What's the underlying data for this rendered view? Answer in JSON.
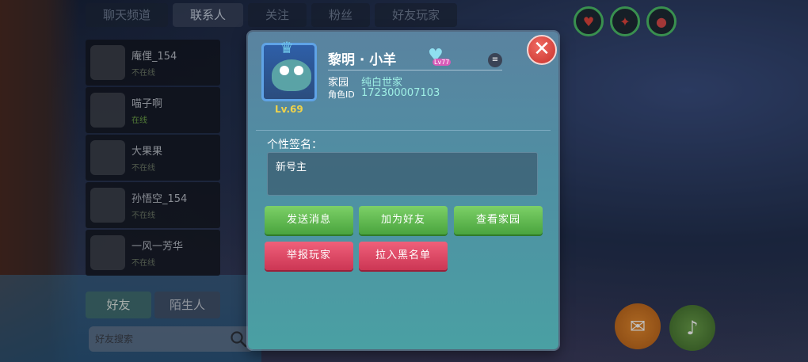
{
  "background_tabs": [
    "聊天频道",
    "联系人",
    "关注",
    "粉丝",
    "好友玩家"
  ],
  "contacts": [
    {
      "name": "庵俚_154",
      "sub": "不在线"
    },
    {
      "name": "喵子啊",
      "sub": "在线"
    },
    {
      "name": "大果果",
      "sub": "不在线"
    },
    {
      "name": "孙悟空_154",
      "sub": "不在线"
    },
    {
      "name": "一风一芳华",
      "sub": "不在线"
    }
  ],
  "bottom_tabs": [
    "好友",
    "陌生人"
  ],
  "search": {
    "placeholder": "好友搜索"
  },
  "profile": {
    "name": "黎明 · 小羊",
    "level": "Lv.69",
    "vip_badge": "Lv77",
    "home_label": "家园",
    "home_value": "纯白世家",
    "id_label": "角色ID",
    "id_value": "172300007103"
  },
  "signature": {
    "label": "个性签名：",
    "text": "新号主"
  },
  "buttons": {
    "send_message": "发送消息",
    "add_friend": "加为好友",
    "view_home": "查看家园",
    "report_player": "举报玩家",
    "blacklist": "拉入黑名单"
  },
  "icons": {
    "close": "close-icon",
    "note": "note-icon",
    "search": "search-icon"
  },
  "colors": {
    "accent_green": "#4aa43e",
    "accent_red": "#cc3654",
    "highlight_cyan": "#9ff0e5",
    "level_gold": "#f0d24a"
  }
}
